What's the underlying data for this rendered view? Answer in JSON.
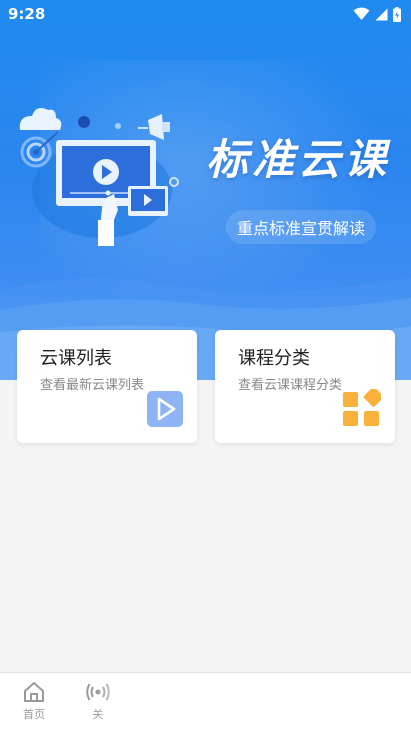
{
  "status_bar": {
    "time": "9:28"
  },
  "hero": {
    "title": "标准云课",
    "subtitle": "重点标准宣贯解读"
  },
  "cards": [
    {
      "title": "云课列表",
      "desc": "查看最新云课列表",
      "icon": "play-icon"
    },
    {
      "title": "课程分类",
      "desc": "查看云课课程分类",
      "icon": "category-icon"
    }
  ],
  "nav": {
    "items": [
      {
        "label": "首页",
        "icon": "home-icon"
      },
      {
        "label": "关",
        "icon": "broadcast-icon"
      }
    ]
  },
  "colors": {
    "hero_blue": "#1f8af0",
    "play_icon_blue": "#8fb4f5",
    "category_orange": "#f8b23c"
  }
}
